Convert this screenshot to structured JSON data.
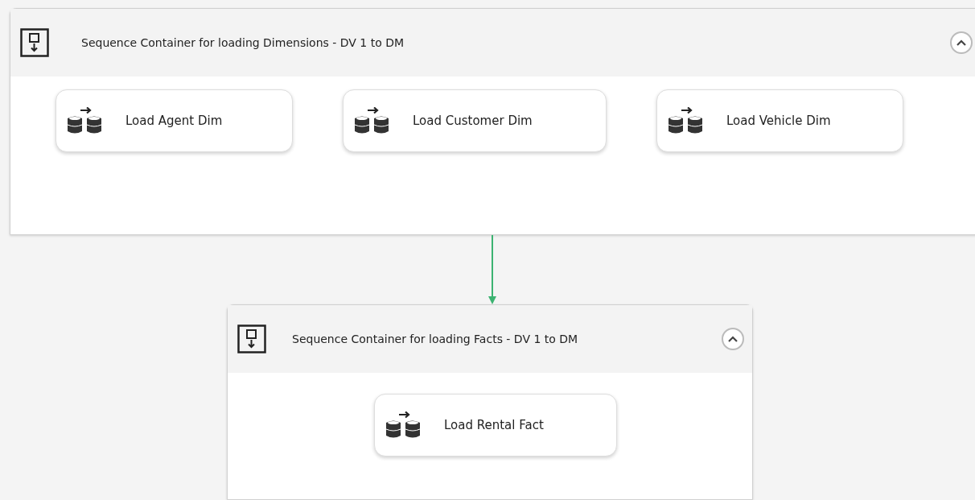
{
  "containers": [
    {
      "title": "Sequence Container for loading Dimensions - DV 1 to DM",
      "expanded": true,
      "tasks": [
        {
          "label": "Load Agent Dim"
        },
        {
          "label": "Load Customer Dim"
        },
        {
          "label": "Load Vehicle Dim"
        }
      ]
    },
    {
      "title": "Sequence Container for loading Facts - DV 1 to DM",
      "expanded": true,
      "tasks": [
        {
          "label": "Load Rental Fact"
        }
      ]
    }
  ],
  "precedence": [
    {
      "color": "#3cb371"
    }
  ]
}
